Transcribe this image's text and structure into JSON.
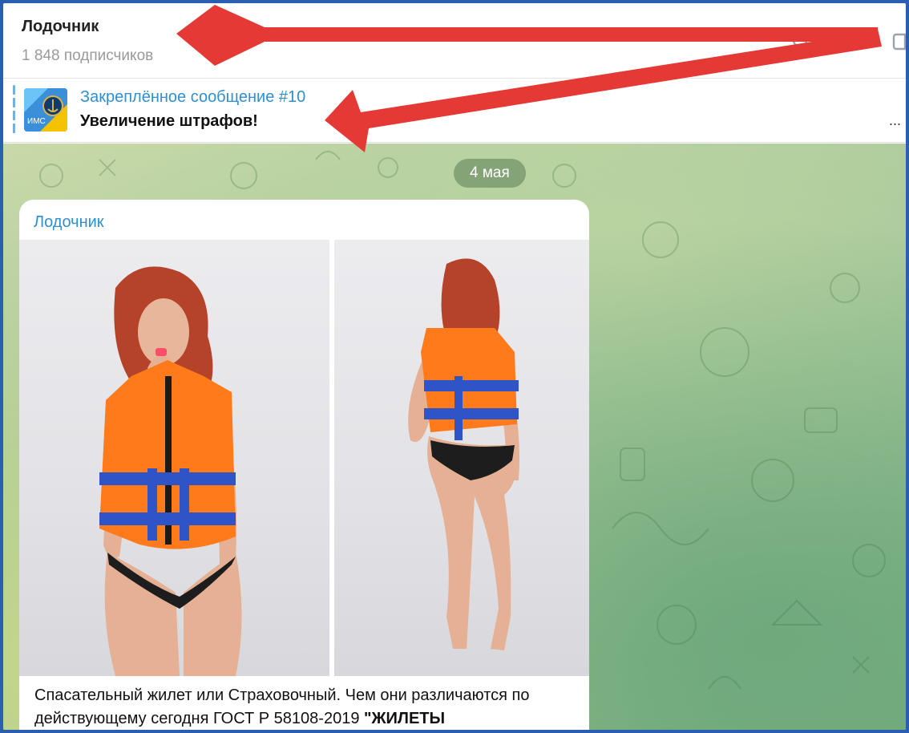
{
  "header": {
    "title": "Лодочник",
    "subscribers": "1 848 подписчиков",
    "icons": [
      "search-icon",
      "live-stream-icon",
      "sidebar-toggle-icon"
    ]
  },
  "pinned": {
    "title": "Закреплённое сообщение #10",
    "text": "Увеличение штрафов!",
    "more": "...",
    "thumb_text": "ИМС"
  },
  "chat": {
    "date": "4 мая",
    "message": {
      "author": "Лодочник",
      "caption_text": "Спасательный жилет или Страховочный. Чем они различаются по действующему сегодня ГОСТ Р 58108-2019 ",
      "caption_bold": "\"ЖИЛЕТЫ"
    }
  },
  "colors": {
    "accent": "#2f8fd0",
    "arrow": "#e53935",
    "vest": "#ff7a1a",
    "strap": "#2f54c8"
  }
}
